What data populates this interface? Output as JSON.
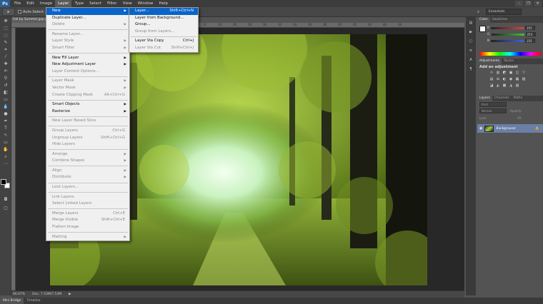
{
  "menubar": {
    "logo": "Ps",
    "items": [
      "File",
      "Edit",
      "Image",
      "Layer",
      "Type",
      "Select",
      "Filter",
      "View",
      "Window",
      "Help"
    ],
    "active_index": 3,
    "window_controls": [
      "–",
      "❐",
      "✕"
    ]
  },
  "options": {
    "tool_glyph": "▸",
    "auto_select": "Auto-Select:",
    "workspace": "Essentials"
  },
  "document": {
    "tab_title": "Fall by Summer.jpg @ 66.7% (RGB/8)",
    "ruler_ticks": [
      "22",
      "24",
      "26",
      "28",
      "30",
      "32",
      "34",
      "36",
      "38",
      "40",
      "42",
      "44",
      "46",
      "48"
    ]
  },
  "status": {
    "zoom": "66.67%",
    "doc_info": "Doc: 7.53M/7.53M"
  },
  "bottom_tabs": [
    "Mini Bridge",
    "Timeline"
  ],
  "layer_menu": [
    {
      "label": "New",
      "arrow": true,
      "highlight": true
    },
    {
      "label": "Duplicate Layer..."
    },
    {
      "label": "Delete",
      "arrow": true,
      "disabled": true
    },
    {
      "sep": true
    },
    {
      "label": "Rename Layer...",
      "disabled": true
    },
    {
      "label": "Layer Style",
      "arrow": true,
      "disabled": true
    },
    {
      "label": "Smart Filter",
      "arrow": true,
      "disabled": true
    },
    {
      "sep": true
    },
    {
      "label": "New Fill Layer",
      "arrow": true
    },
    {
      "label": "New Adjustment Layer",
      "arrow": true
    },
    {
      "label": "Layer Content Options...",
      "disabled": true
    },
    {
      "sep": true
    },
    {
      "label": "Layer Mask",
      "arrow": true,
      "disabled": true
    },
    {
      "label": "Vector Mask",
      "arrow": true,
      "disabled": true
    },
    {
      "label": "Create Clipping Mask",
      "shortcut": "Alt+Ctrl+G",
      "disabled": true
    },
    {
      "sep": true
    },
    {
      "label": "Smart Objects",
      "arrow": true
    },
    {
      "label": "Rasterize",
      "arrow": true
    },
    {
      "sep": true
    },
    {
      "label": "New Layer Based Slice",
      "disabled": true
    },
    {
      "sep": true
    },
    {
      "label": "Group Layers",
      "shortcut": "Ctrl+G",
      "disabled": true
    },
    {
      "label": "Ungroup Layers",
      "shortcut": "Shift+Ctrl+G",
      "disabled": true
    },
    {
      "label": "Hide Layers",
      "disabled": true
    },
    {
      "sep": true
    },
    {
      "label": "Arrange",
      "arrow": true,
      "disabled": true
    },
    {
      "label": "Combine Shapes",
      "arrow": true,
      "disabled": true
    },
    {
      "sep": true
    },
    {
      "label": "Align",
      "arrow": true,
      "disabled": true
    },
    {
      "label": "Distribute",
      "arrow": true,
      "disabled": true
    },
    {
      "sep": true
    },
    {
      "label": "Lock Layers...",
      "disabled": true
    },
    {
      "sep": true
    },
    {
      "label": "Link Layers",
      "disabled": true
    },
    {
      "label": "Select Linked Layers",
      "disabled": true
    },
    {
      "sep": true
    },
    {
      "label": "Merge Layers",
      "shortcut": "Ctrl+E",
      "disabled": true
    },
    {
      "label": "Merge Visible",
      "shortcut": "Shift+Ctrl+E",
      "disabled": true
    },
    {
      "label": "Flatten Image",
      "disabled": true
    },
    {
      "sep": true
    },
    {
      "label": "Matting",
      "arrow": true,
      "disabled": true
    }
  ],
  "new_submenu": [
    {
      "label": "Layer...",
      "shortcut": "Shift+Ctrl+N",
      "highlight": true
    },
    {
      "label": "Layer from Background..."
    },
    {
      "label": "Group..."
    },
    {
      "label": "Group from Layers...",
      "disabled": true
    },
    {
      "sep": true
    },
    {
      "label": "Layer Via Copy",
      "shortcut": "Ctrl+J"
    },
    {
      "label": "Layer Via Cut",
      "shortcut": "Shift+Ctrl+J",
      "disabled": true
    }
  ],
  "color_panel": {
    "tabs": [
      "Color",
      "Swatches"
    ],
    "rows": [
      {
        "label": "R",
        "value": "255",
        "color": "#e04040"
      },
      {
        "label": "G",
        "value": "255",
        "color": "#40c040"
      },
      {
        "label": "B",
        "value": "255",
        "color": "#4060e0"
      }
    ]
  },
  "adjustments_panel": {
    "tabs": [
      "Adjustments",
      "Styles"
    ],
    "heading": "Add an adjustment",
    "icons_row1": [
      "☼",
      "▥",
      "◩",
      "▣",
      "◫",
      "▽"
    ],
    "icons_row2": [
      "▤",
      "⚖",
      "◐",
      "◉",
      "▦",
      "▧"
    ],
    "icons_row3": [
      "◪",
      "◭",
      "▩",
      "◮",
      "▨"
    ]
  },
  "layers_panel": {
    "tabs": [
      "Layers",
      "Channels",
      "Paths"
    ],
    "kind": "Kind",
    "blend": "Normal",
    "opacity_label": "Opacity:",
    "lock_label": "Lock:",
    "fill_label": "Fill:",
    "layer_name": "Background"
  }
}
